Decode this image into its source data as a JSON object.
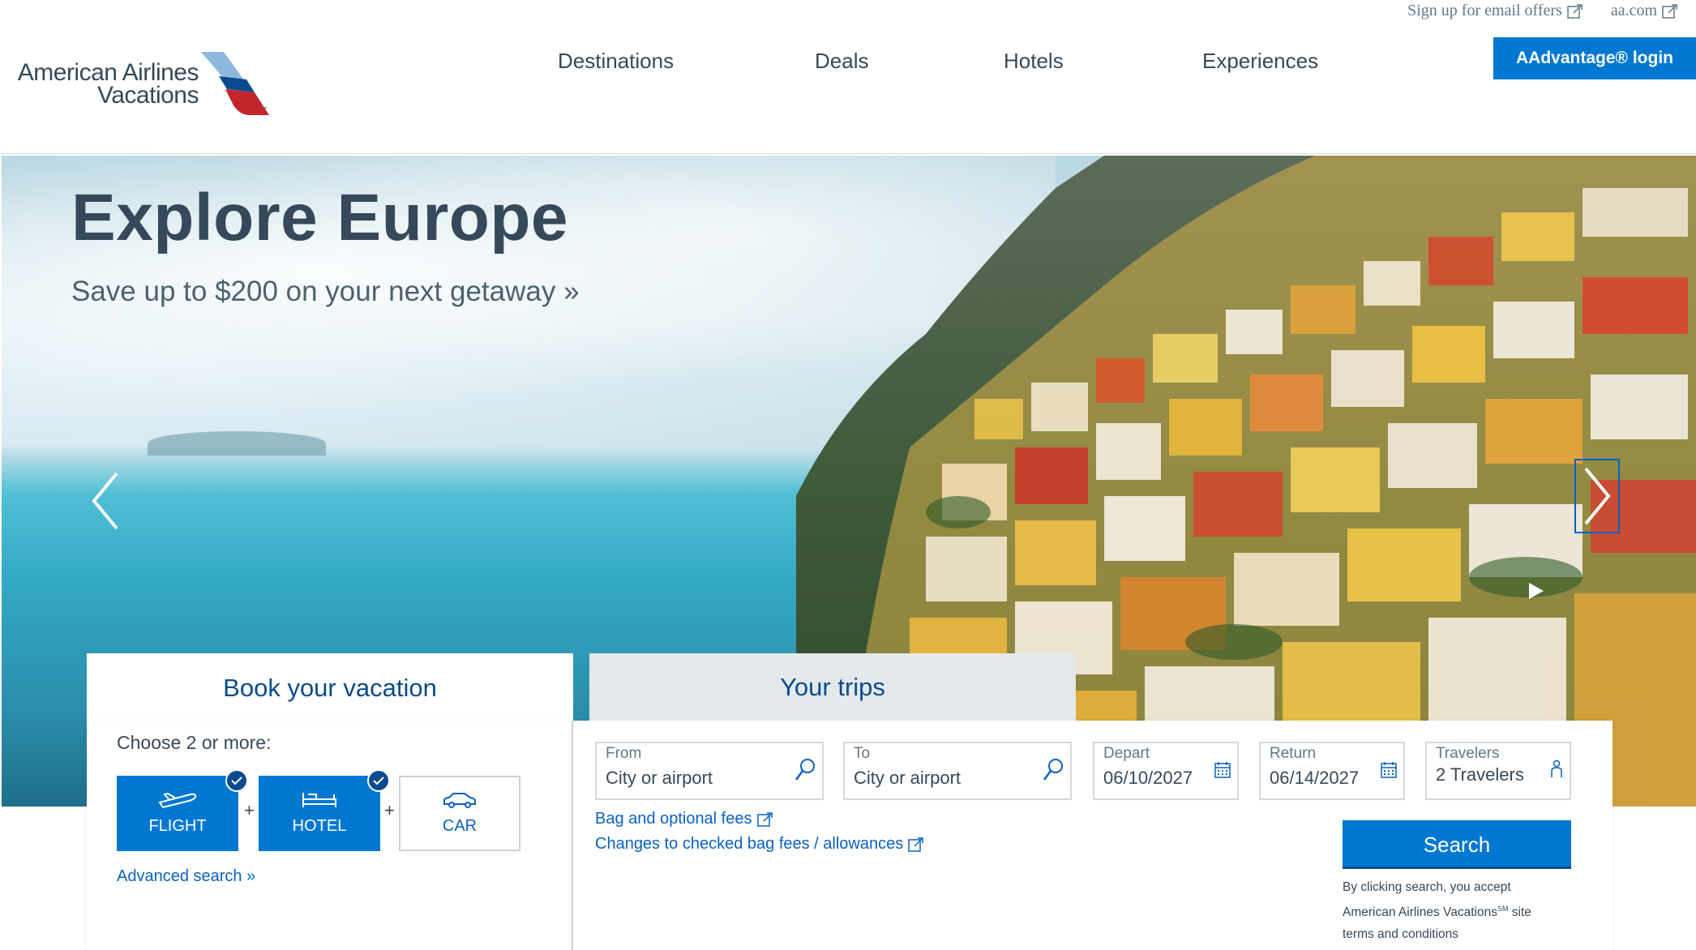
{
  "utility": {
    "email_offers": "Sign up for email offers",
    "aa_com": "aa.com"
  },
  "logo": {
    "line1": "American Airlines",
    "line2": "Vacations",
    "tm": "™"
  },
  "nav": {
    "items": [
      "Destinations",
      "Deals",
      "Hotels",
      "Experiences"
    ],
    "login": "AAdvantage® login"
  },
  "hero": {
    "title": "Explore Europe",
    "subtitle": "Save up to $200 on your next getaway »"
  },
  "tabs": {
    "book": "Book your vacation",
    "trips": "Your trips"
  },
  "booking": {
    "choose": "Choose 2 or more:",
    "products": [
      {
        "label": "FLIGHT",
        "selected": true
      },
      {
        "label": "HOTEL",
        "selected": true
      },
      {
        "label": "CAR",
        "selected": false
      }
    ],
    "plus": "+",
    "advanced": "Advanced search  »",
    "from": {
      "label": "From",
      "placeholder": "City or airport"
    },
    "to": {
      "label": "To",
      "placeholder": "City or airport"
    },
    "depart": {
      "label": "Depart",
      "value": "06/10/2027"
    },
    "return": {
      "label": "Return",
      "value": "06/14/2027"
    },
    "travelers": {
      "label": "Travelers",
      "value": "2 Travelers"
    },
    "bag_fees": "Bag and optional fees",
    "checked_bag": "Changes to checked bag fees / allowances",
    "search": "Search",
    "terms_line1": "By clicking search, you accept",
    "terms_line2": "American Airlines Vacations",
    "terms_sm": "SM",
    "terms_line2b": " site",
    "terms_line3": "terms and conditions"
  },
  "colors": {
    "brand_blue": "#0078d2",
    "dark_blue": "#0a4b8f",
    "link_blue": "#0a61c4",
    "text_slate": "#36495a"
  }
}
